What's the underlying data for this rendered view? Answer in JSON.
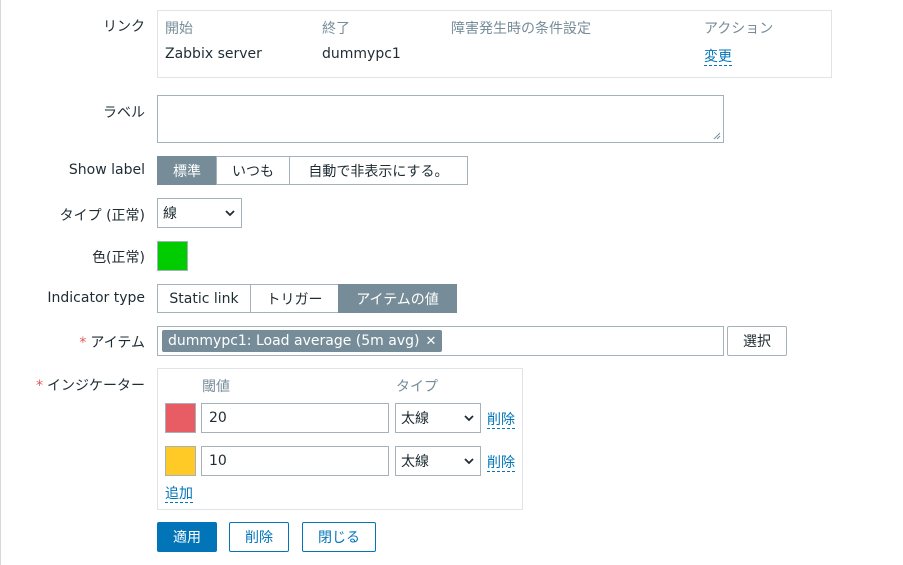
{
  "form": {
    "link": {
      "label": "リンク",
      "headers": [
        "開始",
        "終了",
        "障害発生時の条件設定",
        "アクション"
      ],
      "row": {
        "from": "Zabbix server",
        "to": "dummypc1",
        "condition": "",
        "action": "変更"
      }
    },
    "label_field": {
      "label": "ラベル",
      "value": ""
    },
    "show_label": {
      "label": "Show label",
      "options": [
        "標準",
        "いつも",
        "自動で非表示にする。"
      ],
      "selected": "標準"
    },
    "type_ok": {
      "label": "タイプ (正常)",
      "value": "線"
    },
    "color_ok": {
      "label": "色(正常)",
      "color": "#00cc00"
    },
    "indicator_type": {
      "label": "Indicator type",
      "options": [
        "Static link",
        "トリガー",
        "アイテムの値"
      ],
      "selected": "アイテムの値"
    },
    "item": {
      "label": "アイテム",
      "required_mark": "*",
      "chip": "dummypc1: Load average (5m avg)",
      "select_button": "選択"
    },
    "indicators": {
      "label": "インジケーター",
      "required_mark": "*",
      "headers": {
        "threshold": "閾値",
        "type": "タイプ"
      },
      "rows": [
        {
          "color": "#e85c63",
          "threshold": "20",
          "type": "太線",
          "remove": "削除"
        },
        {
          "color": "#ffc926",
          "threshold": "10",
          "type": "太線",
          "remove": "削除"
        }
      ],
      "add": "追加"
    },
    "buttons": {
      "apply": "適用",
      "remove": "削除",
      "close": "閉じる"
    }
  }
}
